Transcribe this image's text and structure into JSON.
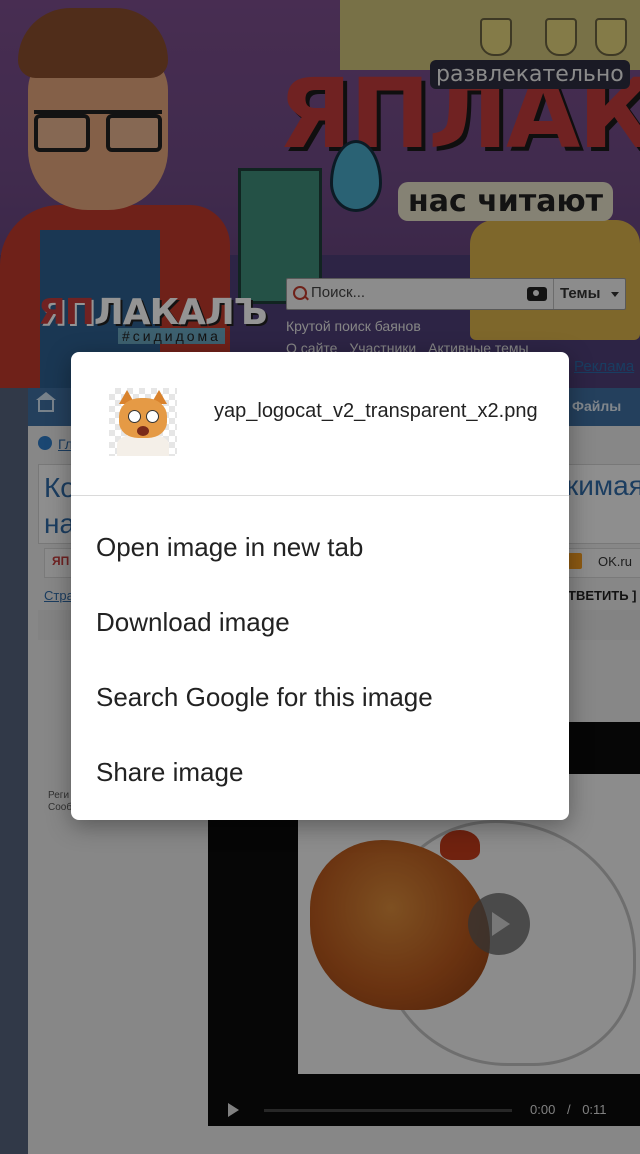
{
  "background_page": {
    "banner": {
      "logo_text": "ЯПЛАКА",
      "tagline_top": "развлекательно",
      "tagline_bottom": "нас читают"
    },
    "site_logo": {
      "text_red": "ЯП",
      "text_white": "ЛАКАЛЪ",
      "tag": "#сидидома"
    },
    "search": {
      "placeholder": "Поиск...",
      "themes_label": "Темы"
    },
    "cool_search": "Крутой поиск баянов",
    "nav_links": [
      "О сайте",
      "Участники",
      "Активные темы"
    ],
    "ads_link": "Реклама",
    "navbar": {
      "files_tab": "Файлы"
    },
    "breadcrumb": "Гл",
    "topic_title_left": "Ко",
    "topic_title_left2": "на",
    "topic_title_right": "кимая",
    "share": {
      "ya": "ЯП",
      "ok": "OK.ru"
    },
    "pages_link": "Стра",
    "reply_link": "ТВЕТИТЬ ] [",
    "post_meta": [
      "Реги",
      "Сооб"
    ],
    "video": {
      "time_current": "0:00",
      "time_separator": "/",
      "time_total": "0:11"
    }
  },
  "context_menu": {
    "thumbnail_icon": "cat-thumbnail",
    "filename": "yap_logocat_v2_transparent_x2.png",
    "items": [
      {
        "label": "Open image in new tab"
      },
      {
        "label": "Download image"
      },
      {
        "label": "Search Google for this image"
      },
      {
        "label": "Share image"
      }
    ]
  }
}
